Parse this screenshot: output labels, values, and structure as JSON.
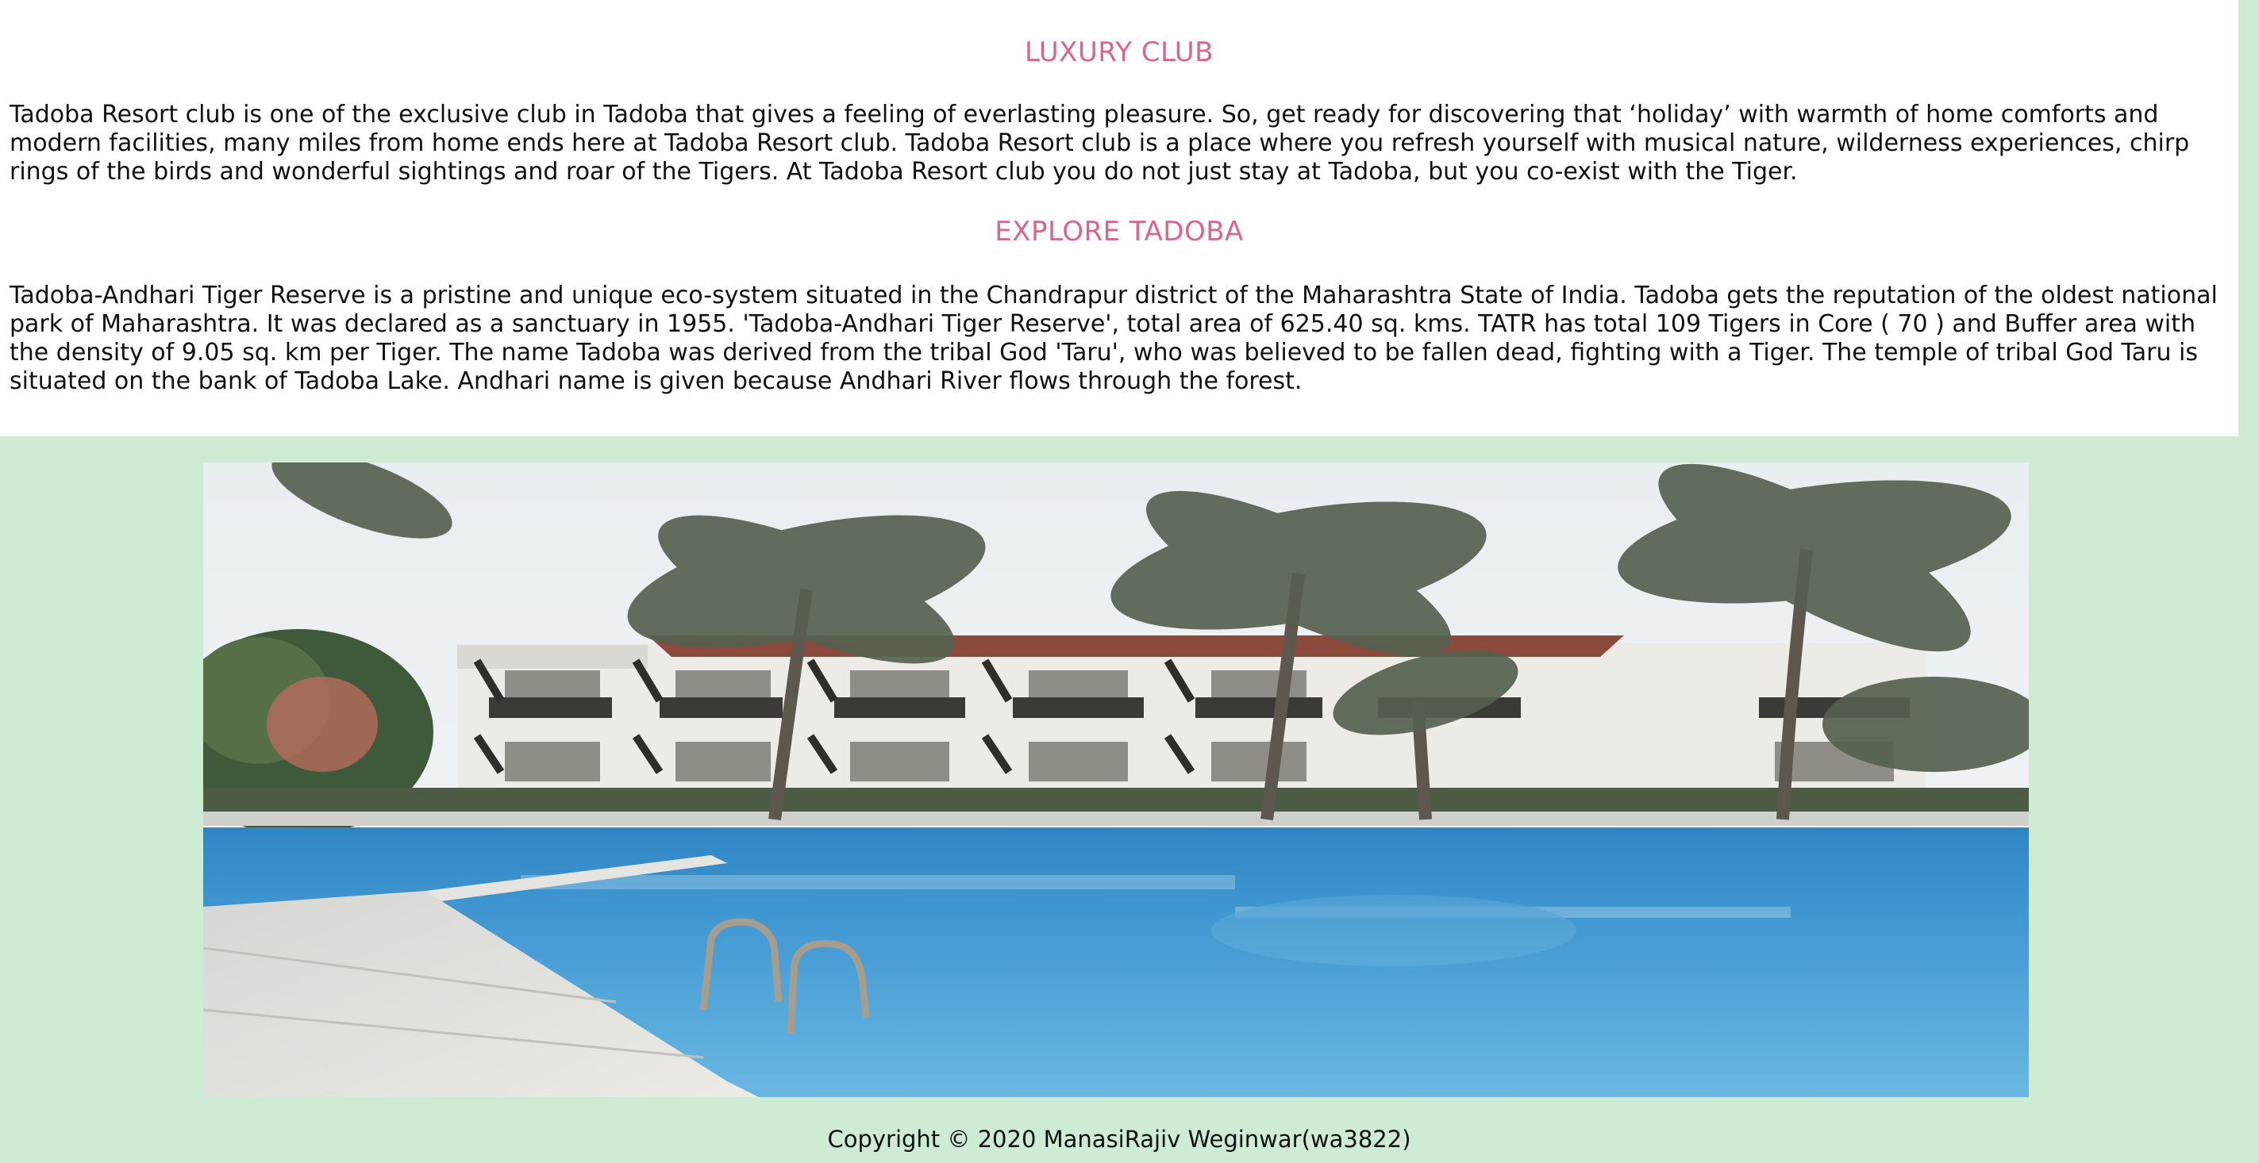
{
  "sections": [
    {
      "title": "LUXURY CLUB",
      "text": "Tadoba Resort club is one of the exclusive club in Tadoba that gives a feeling of everlasting pleasure. So, get ready for discovering that ‘holiday’ with warmth of home comforts and modern facilities, many miles from home ends here at Tadoba Resort club. Tadoba Resort club is a place where you refresh yourself with musical nature, wilderness experiences, chirp rings of the birds and wonderful sightings and roar of the Tigers. At Tadoba Resort club you do not just stay at Tadoba, but you co-exist with the Tiger."
    },
    {
      "title": "EXPLORE TADOBA",
      "text": "Tadoba-Andhari Tiger Reserve is a pristine and unique eco-system situated in the Chandrapur district of the Maharashtra State of India. Tadoba gets the reputation of the oldest national park of Maharashtra. It was declared as a sanctuary in 1955. 'Tadoba-Andhari Tiger Reserve', total area of 625.40 sq. kms. TATR has total 109 Tigers in Core ( 70 ) and Buffer area with the density of 9.05 sq. km per Tiger. The name Tadoba was derived from the tribal God 'Taru', who was believed to be fallen dead, fighting with a Tiger. The temple of tribal God Taru is situated on the bank of Tadoba Lake. Andhari name is given because Andhari River flows through the forest."
    }
  ],
  "footer": {
    "copyright": "Copyright © 2020 ManasiRajiv Weginwar(wa3822)"
  },
  "colors": {
    "page_background": "#ceecd4",
    "panel_background": "#ffffff",
    "heading": "#d9658e",
    "text": "#111111"
  }
}
